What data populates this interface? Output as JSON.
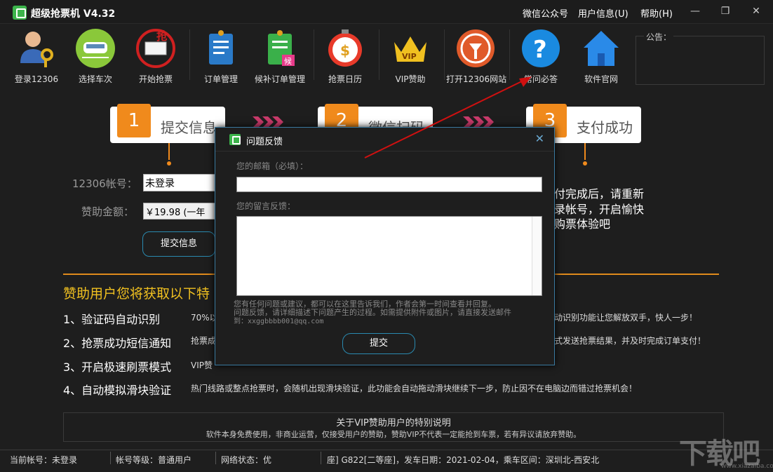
{
  "app": {
    "title": "超级抢票机 V4.32",
    "links": [
      "微信公众号",
      "用户信息(U)",
      "帮助(H)"
    ]
  },
  "toolbar": [
    {
      "label": "登录12306",
      "icon": "user-key-icon"
    },
    {
      "label": "选择车次",
      "icon": "train-icon"
    },
    {
      "label": "开始抢票",
      "icon": "grab-ticket-icon"
    },
    {
      "label": "订单管理",
      "icon": "order-doc-icon"
    },
    {
      "label": "候补订单管理",
      "icon": "waitlist-doc-icon"
    },
    {
      "label": "抢票日历",
      "icon": "clock-money-icon"
    },
    {
      "label": "VIP赞助",
      "icon": "vip-crown-icon"
    },
    {
      "label": "打开12306网站",
      "icon": "railway-logo-icon"
    },
    {
      "label": "常问必答",
      "icon": "help-question-icon"
    },
    {
      "label": "软件官网",
      "icon": "home-icon"
    }
  ],
  "notice": {
    "label": "公告："
  },
  "steps": [
    {
      "num": "1",
      "text": "提交信息"
    },
    {
      "num": "2",
      "text": "微信扫码"
    },
    {
      "num": "3",
      "text": "支付成功"
    }
  ],
  "form": {
    "account_label": "12306帐号：",
    "account_value": "未登录",
    "amount_label": "赞助金额：",
    "amount_value": "￥19.98 (一年",
    "submit_label": "提交信息"
  },
  "promo_lines": [
    "付完成后，请重新",
    "录帐号，开启愉快",
    "购票体验吧"
  ],
  "benefits": {
    "title": "赞助用户您将获取以下特",
    "items": [
      {
        "head": "1、验证码自动识别",
        "desc": "70%以",
        "tail": "动识别功能让您解放双手，快人一步！"
      },
      {
        "head": "2、抢票成功短信通知",
        "desc": "抢票成",
        "tail": "式发送抢票结果，并及时完成订单支付！"
      },
      {
        "head": "3、开启极速刷票模式",
        "desc": "VIP赞",
        "tail": ""
      },
      {
        "head": "4、自动模拟滑块验证",
        "desc": "热门线路或整点抢票时，会随机出现滑块验证，此功能会自动拖动滑块继续下一步，防止因不在电脑边而错过抢票机会！",
        "tail": ""
      }
    ]
  },
  "vip_note": {
    "title": "关于VIP赞助用户的特别说明",
    "desc": "软件本身免费使用，非商业运营，仅接受用户的赞助，赞助VIP不代表一定能抢到车票，若有异议请放弃赞助。"
  },
  "status": {
    "account": "当前帐号：未登录",
    "level": "帐号等级：普通用户",
    "network": "网络状态：优",
    "train": "座] G822[二等座]，发车日期：2021-02-04，乘车区间：深圳北-西安北"
  },
  "dialog": {
    "title": "问题反馈",
    "email_label": "您的邮箱（必填）：",
    "message_label": "您的留言反馈：",
    "note_lines": [
      "您有任何问题或建议，都可以在这里告诉我们，作者会第一时间查看并回复。",
      "问题反馈，请详细描述下问题产生的过程。如需提供附件或图片，请直接发送邮件",
      "到：xxggbbbb001@qq.com"
    ],
    "submit_label": "提交"
  },
  "watermark": {
    "main": "下载吧",
    "sub": "www.xiazaiba.com"
  },
  "colors": {
    "accent_orange": "#f08a1c",
    "accent_blue": "#2a8ab0",
    "title_yellow": "#f0c020",
    "arrow_red": "#d01010"
  }
}
